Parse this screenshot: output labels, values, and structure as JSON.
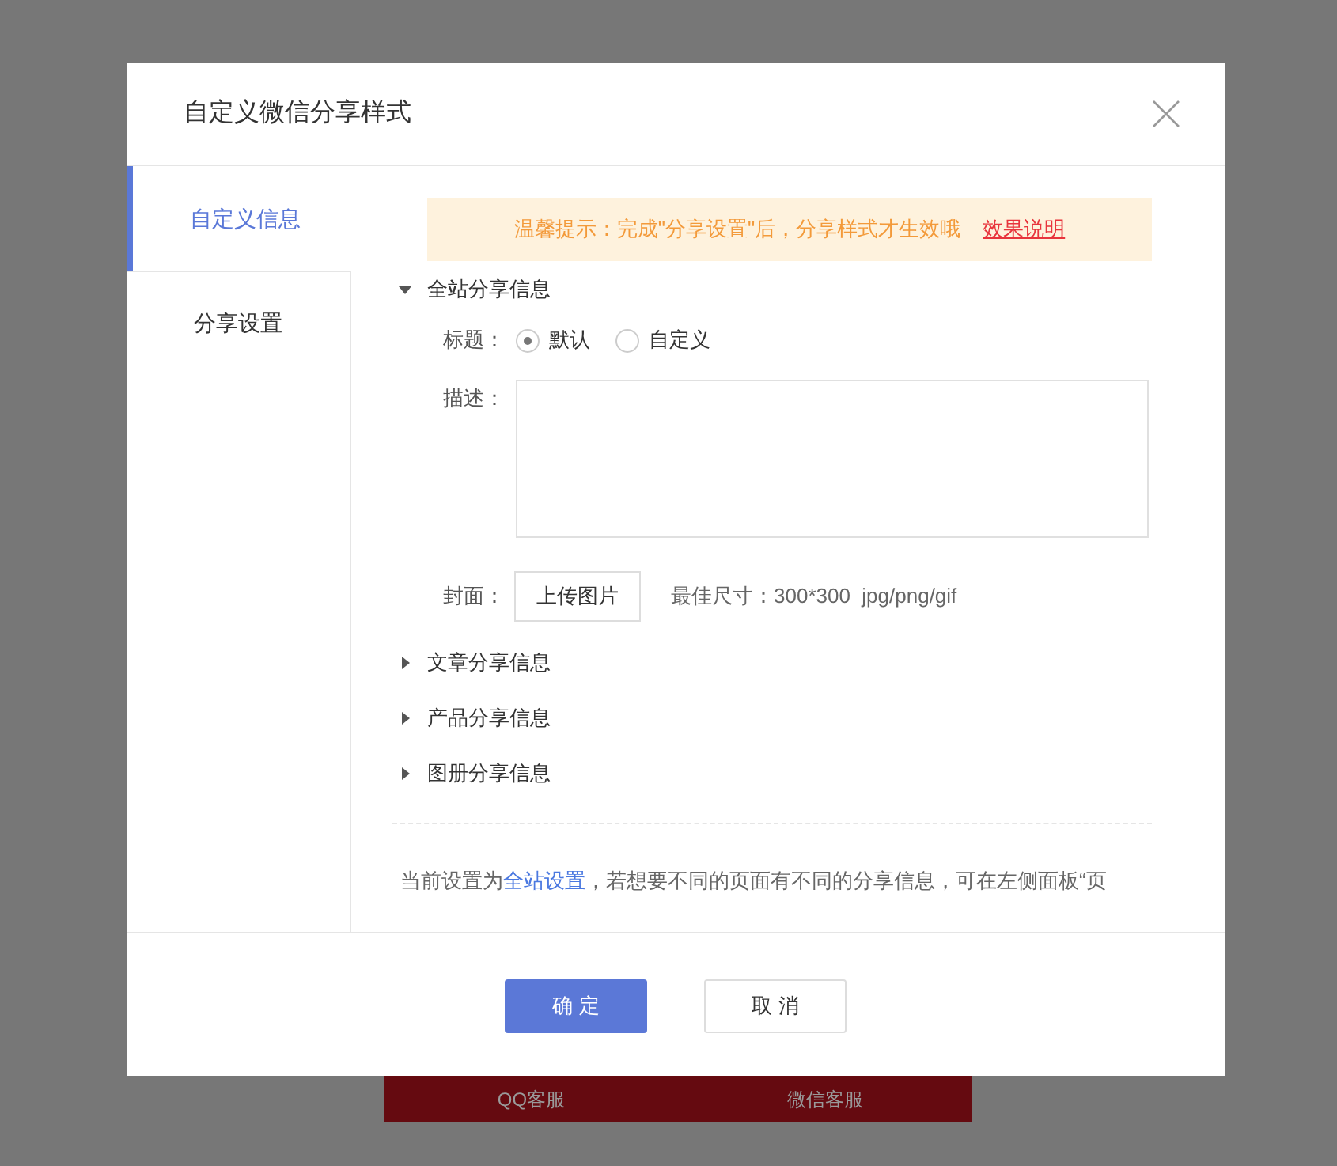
{
  "dialog": {
    "title": "自定义微信分享样式"
  },
  "tabs": [
    {
      "label": "自定义信息",
      "selected": true
    },
    {
      "label": "分享设置",
      "selected": false
    }
  ],
  "notice": {
    "text": "温馨提示：完成\"分享设置\"后，分享样式才生效哦",
    "link": "效果说明"
  },
  "sections": [
    {
      "title": "全站分享信息",
      "expanded": true
    },
    {
      "title": "文章分享信息",
      "expanded": false
    },
    {
      "title": "产品分享信息",
      "expanded": false
    },
    {
      "title": "图册分享信息",
      "expanded": false
    }
  ],
  "form": {
    "title_label": "标题：",
    "title_options": [
      {
        "label": "默认",
        "selected": true
      },
      {
        "label": "自定义",
        "selected": false
      }
    ],
    "desc_label": "描述：",
    "cover_label": "封面：",
    "upload_button": "上传图片",
    "size_hint": "最佳尺寸：300*300  jpg/png/gif"
  },
  "footnote": {
    "before": "当前设置为",
    "link": "全站设置",
    "after": "，若想要不同的页面有不同的分享信息，可在左侧面板“页"
  },
  "buttons": [
    {
      "label": "确 定",
      "kind": "primary"
    },
    {
      "label": "取 消",
      "kind": "secondary"
    }
  ],
  "background_bar": {
    "items": [
      "QQ客服",
      "微信客服"
    ]
  }
}
